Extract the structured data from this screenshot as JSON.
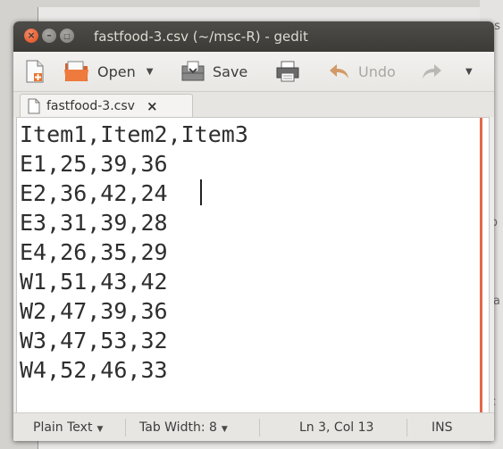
{
  "background": {
    "fragments": [
      "ns",
      "p",
      "ea",
      "c"
    ]
  },
  "window": {
    "title": "fastfood-3.csv (~/msc-R) - gedit"
  },
  "toolbar": {
    "open_label": "Open",
    "save_label": "Save",
    "undo_label": "Undo"
  },
  "tab": {
    "label": "fastfood-3.csv"
  },
  "editor": {
    "lines": [
      "Item1,Item2,Item3",
      "E1,25,39,36",
      "E2,36,42,24",
      "E3,31,39,28",
      "E4,26,35,29",
      "W1,51,43,42",
      "W2,47,39,36",
      "W3,47,53,32",
      "W4,52,46,33"
    ]
  },
  "statusbar": {
    "language": "Plain Text",
    "tab_width": "Tab Width: 8",
    "position": "Ln 3, Col 13",
    "mode": "INS"
  },
  "colors": {
    "titlebar": "#3c3b37",
    "close_button": "#df4a16",
    "right_margin": "#e2684a"
  }
}
